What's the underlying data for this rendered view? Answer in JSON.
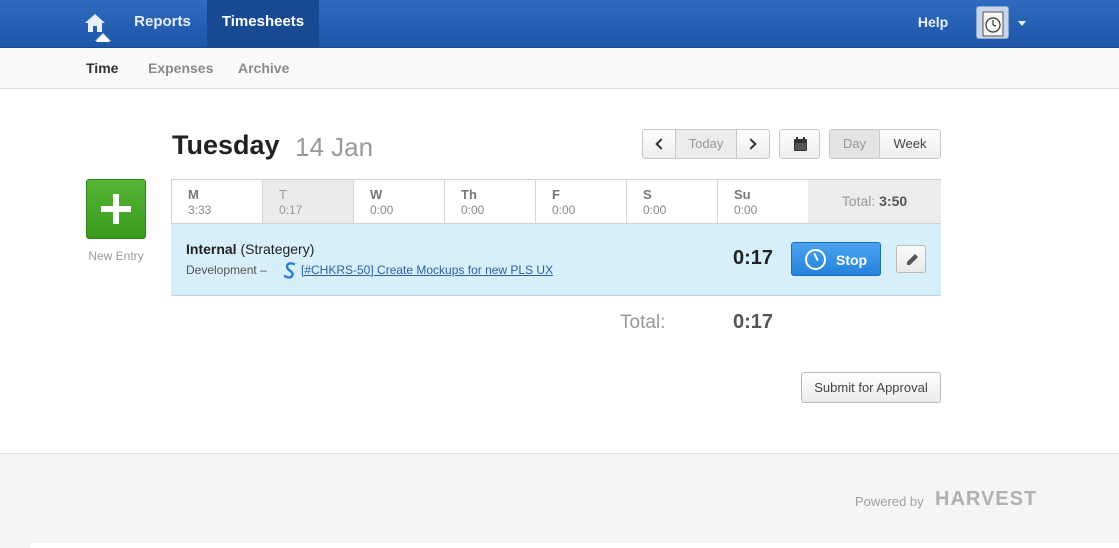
{
  "nav": {
    "reports": "Reports",
    "timesheets": "Timesheets",
    "help": "Help"
  },
  "subnav": {
    "time": "Time",
    "expenses": "Expenses",
    "archive": "Archive"
  },
  "new_entry": {
    "label": "New Entry"
  },
  "date": {
    "day": "Tuesday",
    "date": "14 Jan"
  },
  "date_nav": {
    "today": "Today",
    "day": "Day",
    "week": "Week"
  },
  "week": {
    "days": [
      {
        "label": "M",
        "hours": "3:33"
      },
      {
        "label": "T",
        "hours": "0:17"
      },
      {
        "label": "W",
        "hours": "0:00"
      },
      {
        "label": "Th",
        "hours": "0:00"
      },
      {
        "label": "F",
        "hours": "0:00"
      },
      {
        "label": "S",
        "hours": "0:00"
      },
      {
        "label": "Su",
        "hours": "0:00"
      }
    ],
    "total_label": "Total:",
    "total_value": "3:50"
  },
  "entry": {
    "project": "Internal",
    "client": "(Strategery)",
    "task": "Development",
    "separator": "–",
    "issue_link": "[#CHKRS-50] Create Mockups for new PLS UX",
    "time": "0:17",
    "stop_label": "Stop"
  },
  "totals": {
    "label": "Total:",
    "value": "0:17"
  },
  "submit": {
    "label": "Submit for Approval"
  },
  "footer": {
    "powered_by": "Powered by",
    "brand": "HARVEST"
  },
  "colors": {
    "header": "#2f6bbf",
    "accent": "#2682dc",
    "new_entry": "#3a9a1e",
    "active_row": "#d6effa"
  }
}
